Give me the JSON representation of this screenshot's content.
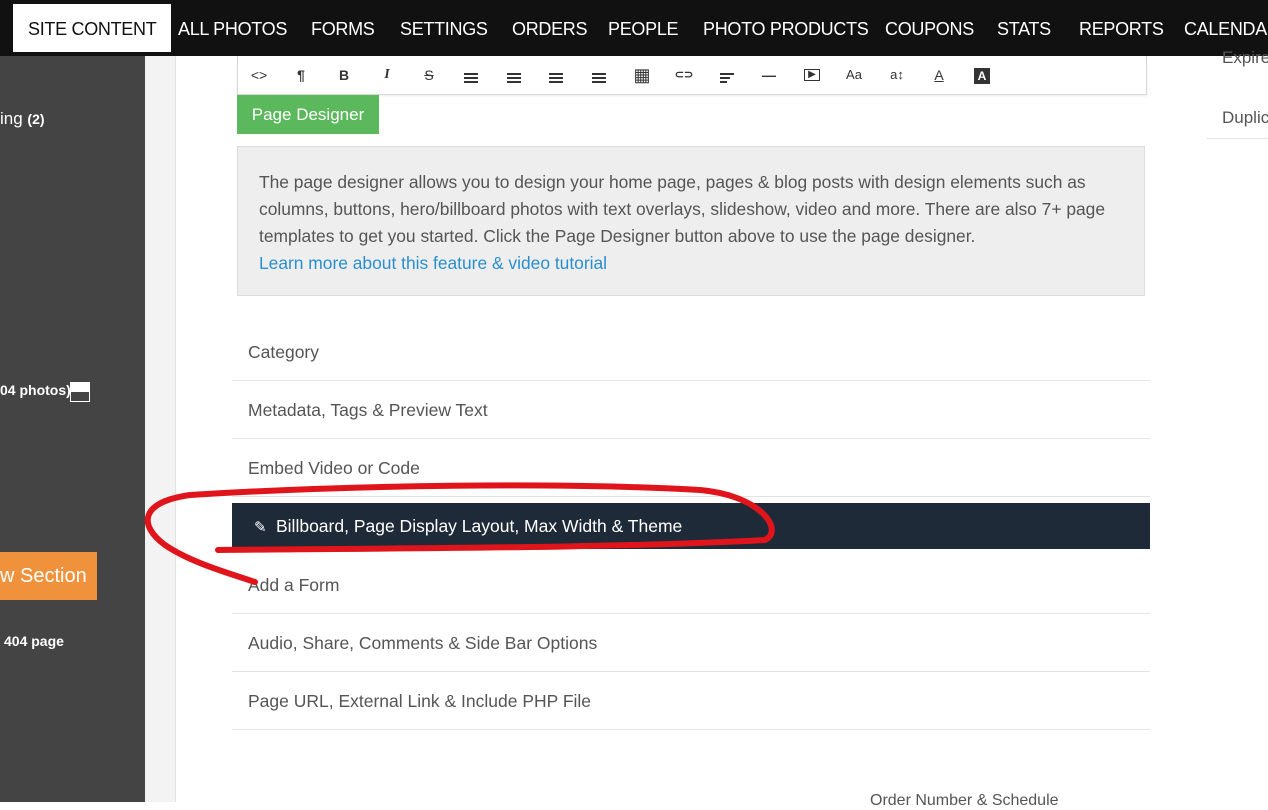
{
  "topnav": {
    "items": [
      {
        "label": "SITE CONTENT",
        "active": true
      },
      {
        "label": "ALL PHOTOS"
      },
      {
        "label": "FORMS"
      },
      {
        "label": "SETTINGS"
      },
      {
        "label": "ORDERS"
      },
      {
        "label": "PEOPLE"
      },
      {
        "label": "PHOTO PRODUCTS"
      },
      {
        "label": "COUPONS"
      },
      {
        "label": "STATS"
      },
      {
        "label": "REPORTS"
      },
      {
        "label": "CALENDAR"
      }
    ]
  },
  "sidebar": {
    "item1_text": "ing",
    "item1_count": "(2)",
    "photos_text": "04 photos)",
    "new_section_label": "w Section",
    "page404_text": "404 page"
  },
  "toolbar": {
    "buttons": [
      {
        "icon": "code-icon",
        "glyph": "<>"
      },
      {
        "icon": "paragraph-icon",
        "glyph": "¶"
      },
      {
        "icon": "bold-icon",
        "glyph": "B"
      },
      {
        "icon": "italic-icon",
        "glyph": "I"
      },
      {
        "icon": "strikethrough-icon",
        "glyph": "S"
      },
      {
        "icon": "unordered-list-icon",
        "glyph": ""
      },
      {
        "icon": "ordered-list-icon",
        "glyph": ""
      },
      {
        "icon": "outdent-icon",
        "glyph": ""
      },
      {
        "icon": "indent-icon",
        "glyph": ""
      },
      {
        "icon": "table-icon",
        "glyph": "▦"
      },
      {
        "icon": "link-icon",
        "glyph": "⊂⊃"
      },
      {
        "icon": "align-icon",
        "glyph": ""
      },
      {
        "icon": "horizontal-rule-icon",
        "glyph": "—"
      },
      {
        "icon": "video-icon",
        "glyph": "▶"
      },
      {
        "icon": "font-family-icon",
        "glyph": "Aa"
      },
      {
        "icon": "font-size-icon",
        "glyph": "a↕"
      },
      {
        "icon": "font-color-icon",
        "glyph": "A"
      },
      {
        "icon": "background-color-icon",
        "glyph": "A"
      }
    ]
  },
  "page_designer": {
    "button_label": "Page Designer",
    "description": "The page designer allows you to design your home page, pages & blog posts with design elements such as columns, buttons, hero/billboard photos with text overlays, slideshow, video and more. There are also 7+ page templates to get you started. Click the Page Designer button above to use the page designer.",
    "learn_more_link": "Learn more about this feature & video tutorial"
  },
  "sections": [
    {
      "label": "Category"
    },
    {
      "label": "Metadata, Tags & Preview Text"
    },
    {
      "label": "Embed Video or Code"
    },
    {
      "label": "Billboard, Page Display Layout, Max Width & Theme",
      "active": true
    },
    {
      "label": "Add a Form"
    },
    {
      "label": "Audio, Share, Comments & Side Bar Options"
    },
    {
      "label": "Page URL, External Link & Include PHP File"
    }
  ],
  "right_column": {
    "items": [
      {
        "label": "Expires"
      },
      {
        "label": "Duplicate"
      }
    ]
  },
  "bottom_text": "Order Number & Schedule",
  "colors": {
    "nav_bg": "#111111",
    "sidebar_bg": "#444444",
    "green_button": "#5cb85c",
    "orange_button": "#f0923b",
    "active_row_bg": "#1f2a38",
    "link": "#2a8fce",
    "annotation": "#e0141b"
  }
}
